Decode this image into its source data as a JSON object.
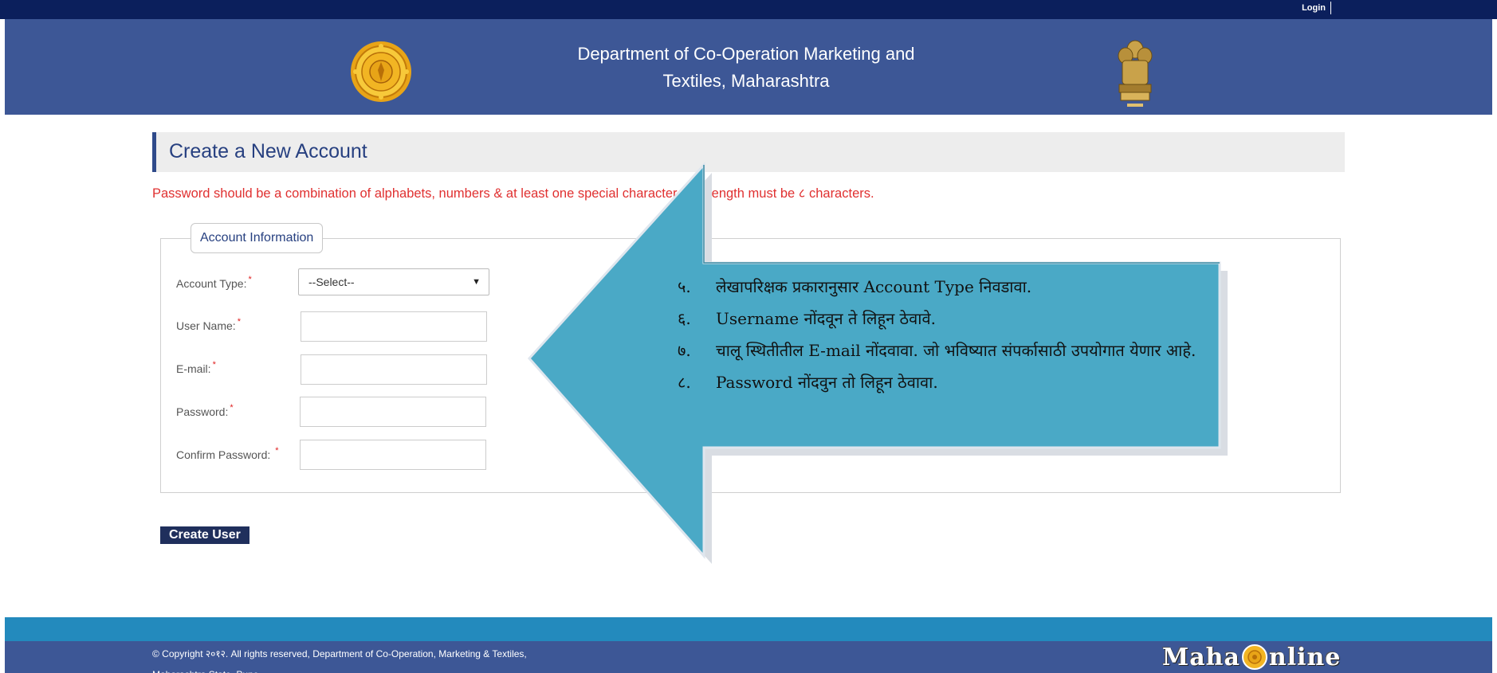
{
  "topbar": {
    "login_label": "Login"
  },
  "header": {
    "title_line1": "Department of Co-Operation Marketing and",
    "title_line2": "Textiles, Maharashtra",
    "left_emblem": "maharashtra-seal-icon",
    "right_emblem": "national-emblem-icon"
  },
  "page": {
    "title": "Create a New Account",
    "password_note": "Password should be a combination of alphabets, numbers & at least one special character. Min length must be ८ characters."
  },
  "form": {
    "legend": "Account Information",
    "account_type": {
      "label": "Account Type:",
      "selected": "--Select--"
    },
    "user_name": {
      "label": "User Name:",
      "value": ""
    },
    "email": {
      "label": "E-mail:",
      "value": ""
    },
    "password": {
      "label": "Password:",
      "value": ""
    },
    "confirm_password": {
      "label": "Confirm Password:",
      "value": ""
    },
    "required_mark": "*",
    "submit_label": "Create User"
  },
  "callout": {
    "items": [
      {
        "num": "५.",
        "text": "लेखापरिक्षक प्रकारानुसार Account Type निवडावा."
      },
      {
        "num": "६.",
        "text": "Username नोंदवून  ते लिहून ठेवावे."
      },
      {
        "num": "७.",
        "text": "चालू स्थितीतील E-mail नोंदवावा. जो भविष्यात संपर्कासाठी उपयोगात येणार आहे."
      },
      {
        "num": "८.",
        "text": "Password नोंदवुन तो लिहून ठेवावा."
      }
    ],
    "fill_color": "#4aa9c6"
  },
  "footer": {
    "copyright_line1": "© Copyright २०१२. All rights reserved, Department of Co-Operation, Marketing & Textiles,",
    "copyright_line2": "Maharashtra State, Pune",
    "logo_part1": "Maha",
    "logo_part2": "nline"
  },
  "colors": {
    "topbar": "#0b1f5c",
    "header": "#3d5796",
    "footer_stripe": "#238abd",
    "warning_text": "#e03030"
  }
}
